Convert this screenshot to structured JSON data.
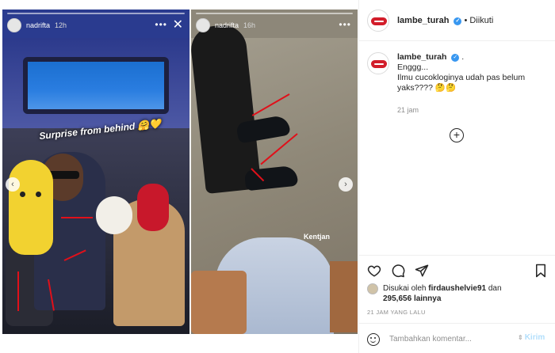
{
  "stories": [
    {
      "user": "nadrifta",
      "time": "12h",
      "sticker_text": "Surprise from behind",
      "emoji": "🤗💛"
    },
    {
      "user": "nadrifta",
      "time": "16h",
      "sticker_text": "Kentjan"
    }
  ],
  "post": {
    "author": "lambe_turah",
    "follow_sep": "•",
    "follow_status": "Diikuti",
    "caption_author": "lambe_turah",
    "caption_tail": ".",
    "caption_lines": [
      "Enggg...",
      "Ilmu cucokloginya udah pas belum",
      "yaks???? 🤔🤔"
    ],
    "caption_time": "21 jam",
    "liked_by_prefix": "Disukai oleh",
    "liked_by_user": "firdaushelvie91",
    "liked_by_mid": "dan",
    "likes_count": "295,656",
    "likes_suffix": "lainnya",
    "post_time": "21 JAM YANG LALU",
    "comment_placeholder": "Tambahkan komentar...",
    "send_label": "Kirim"
  },
  "icons": {
    "like": "heart-icon",
    "comment": "comment-icon",
    "share": "send-icon",
    "save": "bookmark-icon",
    "verified": "verified-badge-icon"
  },
  "colors": {
    "verified": "#3897f0",
    "brand_red": "#d21d2a",
    "send_disabled": "#b2dffc"
  }
}
